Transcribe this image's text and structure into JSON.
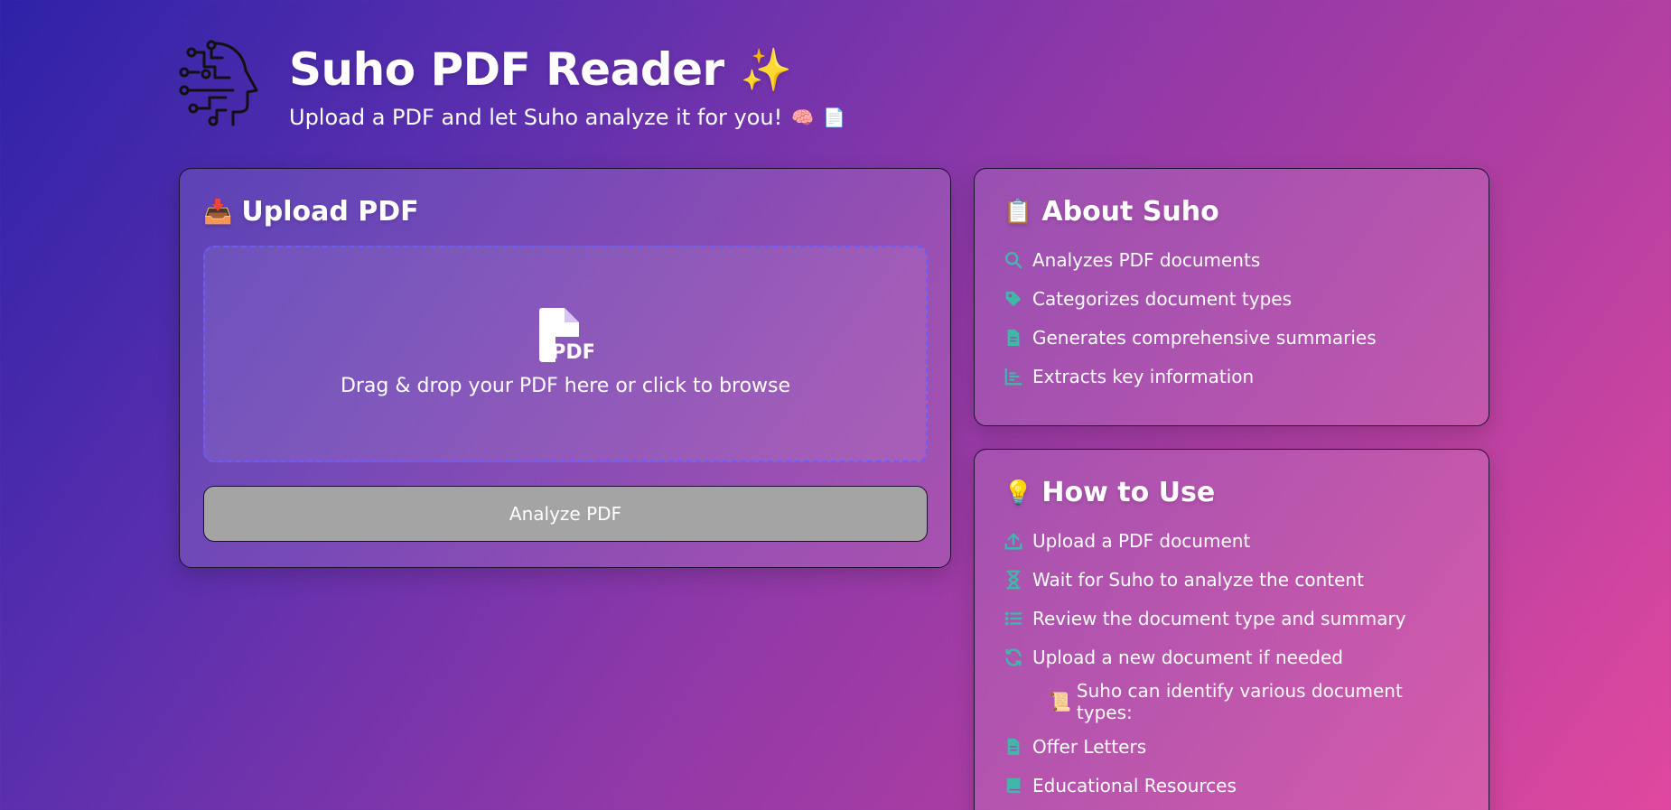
{
  "header": {
    "title": "Suho PDF Reader",
    "title_emoji": "✨",
    "subtitle": "Upload a PDF and let Suho analyze it for you!",
    "subtitle_emojis": [
      "🧠",
      "📄"
    ]
  },
  "upload": {
    "title_emoji": "📥",
    "title": "Upload PDF",
    "drop_text": "Drag & drop your PDF here or click to browse",
    "analyze_label": "Analyze PDF"
  },
  "about": {
    "title_emoji": "📋",
    "title": "About Suho",
    "items": [
      {
        "icon": "search-icon",
        "label": "Analyzes PDF documents"
      },
      {
        "icon": "tag-icon",
        "label": "Categorizes document types"
      },
      {
        "icon": "file-icon",
        "label": "Generates comprehensive summaries"
      },
      {
        "icon": "chart-icon",
        "label": "Extracts key information"
      }
    ]
  },
  "howto": {
    "title_emoji": "💡",
    "title": "How to Use",
    "items": [
      {
        "icon": "upload-icon",
        "label": "Upload a PDF document"
      },
      {
        "icon": "hourglass-icon",
        "label": "Wait for Suho to analyze the content"
      },
      {
        "icon": "list-icon",
        "label": "Review the document type and summary"
      },
      {
        "icon": "refresh-icon",
        "label": "Upload a new document if needed"
      }
    ],
    "note_emoji": "📜",
    "note": "Suho can identify various document types:",
    "doc_types": [
      {
        "icon": "file-icon",
        "label": "Offer Letters"
      },
      {
        "icon": "book-icon",
        "label": "Educational Resources"
      }
    ]
  },
  "colors": {
    "icon_teal": "#3fb8a8",
    "dropzone_border": "#6a5cff",
    "button_bg": "#a4a4a4"
  }
}
